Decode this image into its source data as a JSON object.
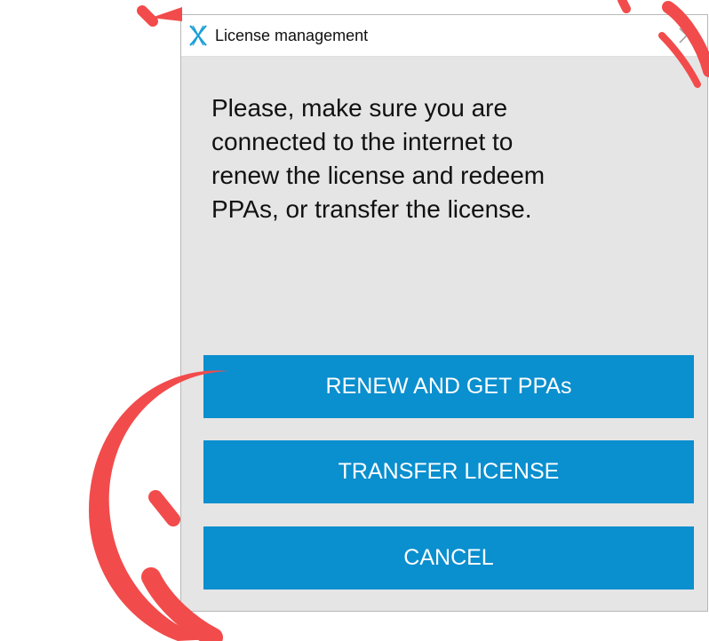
{
  "window": {
    "title": "License management",
    "close_icon": "close-icon",
    "app_icon": "app-logo-icon"
  },
  "dialog": {
    "message": "Please, make sure you are\nconnected to the internet to\nrenew the license and redeem\nPPAs, or transfer the license.",
    "buttons": {
      "renew": "RENEW AND GET PPAs",
      "transfer": "TRANSFER LICENSE",
      "cancel": "CANCEL"
    }
  },
  "colors": {
    "dialog_bg": "#e5e5e5",
    "button_bg": "#0a8fcf",
    "button_text": "#ffffff",
    "logo": "#1a9fd8",
    "watermark": "#f24b4b"
  }
}
